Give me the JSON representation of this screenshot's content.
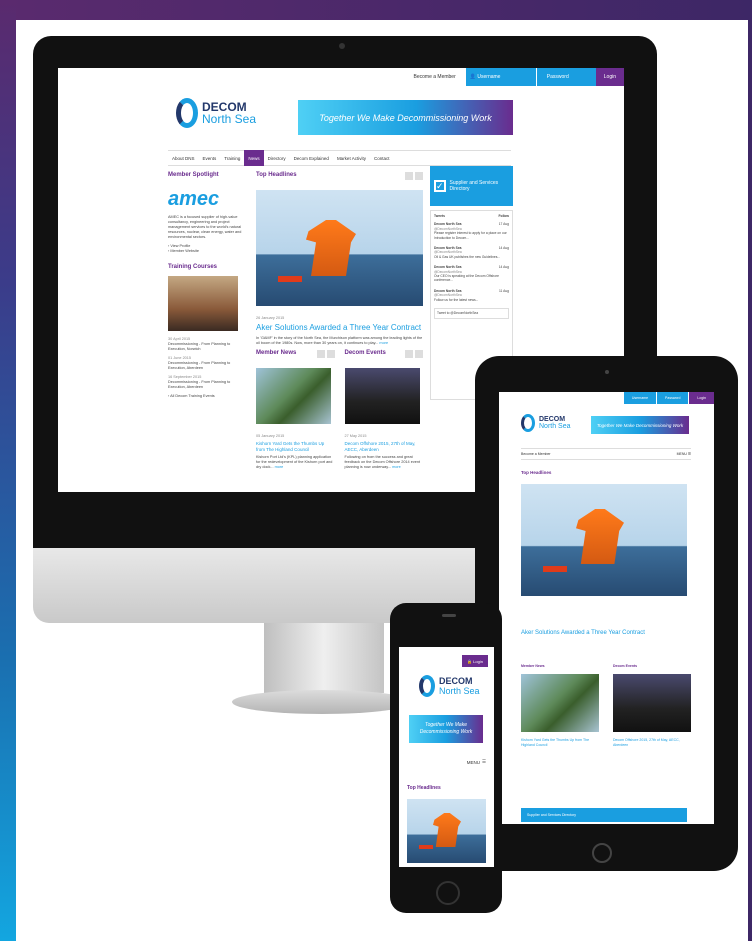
{
  "desktop": {
    "topbar": {
      "become_member": "Become a Member",
      "username": "Username",
      "password": "Password",
      "login": "Login"
    },
    "logo": {
      "line1": "DECOM",
      "line2": "North Sea"
    },
    "banner": "Together We Make Decommissioning Work",
    "nav": [
      "About DNS",
      "Events",
      "Training",
      "News",
      "Directory",
      "Decom Explained",
      "Market Activity",
      "Contact"
    ],
    "member_spotlight": {
      "heading": "Member Spotlight",
      "company": "amec",
      "description": "AMEC is a focused supplier of high-value consultancy, engineering and project management services to the world's natural resources, nuclear, clean energy, water and environmental sectors.",
      "links": [
        "View Profile",
        "Member Website"
      ]
    },
    "training": {
      "heading": "Training Courses",
      "items": [
        {
          "date": "30 April 2015",
          "title": "Decommissioning - From Planning to Execution, Norwich"
        },
        {
          "date": "01 June 2015",
          "title": "Decommissioning - From Planning to Execution, Aberdeen"
        },
        {
          "date": "16 September 2015",
          "title": "Decommissioning - From Planning to Execution, Aberdeen"
        }
      ],
      "all_link": "All Decom Training Events"
    },
    "top_headlines": {
      "heading": "Top Headlines",
      "date": "26 January 2015",
      "headline": "Aker Solutions Awarded a Three Year Contract",
      "summary": "In 'GAMF' in the story of the North Sea, the Murchison platform was among the leading lights of the oil boom of the 1980s. Now, more than 30 years on, it continues to play...",
      "more": "more"
    },
    "member_news": {
      "heading": "Member News",
      "date": "05 January 2015",
      "headline": "Kishorn Yard Gets the Thumbs Up from The Highland Council",
      "summary": "Kishorn Port Ltd's (KPL) planning application for the redevelopment of the Kishorn port and dry dock...",
      "more": "more"
    },
    "decom_events": {
      "heading": "Decom Events",
      "date": "27 May 2015",
      "headline": "Decom Offshore 2015, 27th of May, AECC, Aberdeen",
      "summary": "Following on from the success and great feedback on the Decom Offshore 2014 event planning is now underway...",
      "more": "more"
    },
    "supplier": {
      "label": "Supplier and Services Directory"
    },
    "tweets": {
      "heading": "Tweets",
      "follow": "Follow",
      "items": [
        {
          "name": "Decom North Sea",
          "handle": "@DecomNorthSea",
          "time": "17 Aug",
          "text": "Please register interest to apply for a place on our Introduction to Decom..."
        },
        {
          "name": "Decom North Sea",
          "handle": "@DecomNorthSea",
          "time": "14 Aug",
          "text": "Oil & Gas UK publishes the new Guidelines..."
        },
        {
          "name": "Decom North Sea",
          "handle": "@DecomNorthSea",
          "time": "14 Aug",
          "text": "Our CEO is speaking at the Decom Offshore conference..."
        },
        {
          "name": "Decom North Sea",
          "handle": "@DecomNorthSea",
          "time": "11 Aug",
          "text": "Follow us for the latest news..."
        }
      ],
      "tweet_to": "Tweet to @DecomNorthSea"
    }
  },
  "tablet": {
    "topbar": {
      "username": "Username",
      "password": "Password",
      "login": "Login"
    },
    "logo": {
      "line1": "DECOM",
      "line2": "North Sea"
    },
    "banner": "Together We Make Decommissioning Work",
    "become_member": "Become a Member",
    "menu": "MENU",
    "top_headlines": "Top Headlines",
    "headline": "Aker Solutions Awarded a Three Year Contract",
    "member_news": "Member News",
    "decom_events": "Decom Events",
    "news_headline": "Kishorn Yard Gets the Thumbs Up from The Highland Council",
    "event_headline": "Decom Offshore 2015, 27th of May, AECC, Aberdeen",
    "supplier": "Supplier and Services Directory"
  },
  "phone": {
    "login": "Login",
    "logo": {
      "line1": "DECOM",
      "line2": "North Sea"
    },
    "banner": "Together We Make Decommissioning Work",
    "menu": "MENU",
    "top_headlines": "Top Headlines"
  },
  "colors": {
    "primary_blue": "#1a9ee0",
    "purple": "#6a2c8e",
    "navy": "#23386b"
  }
}
